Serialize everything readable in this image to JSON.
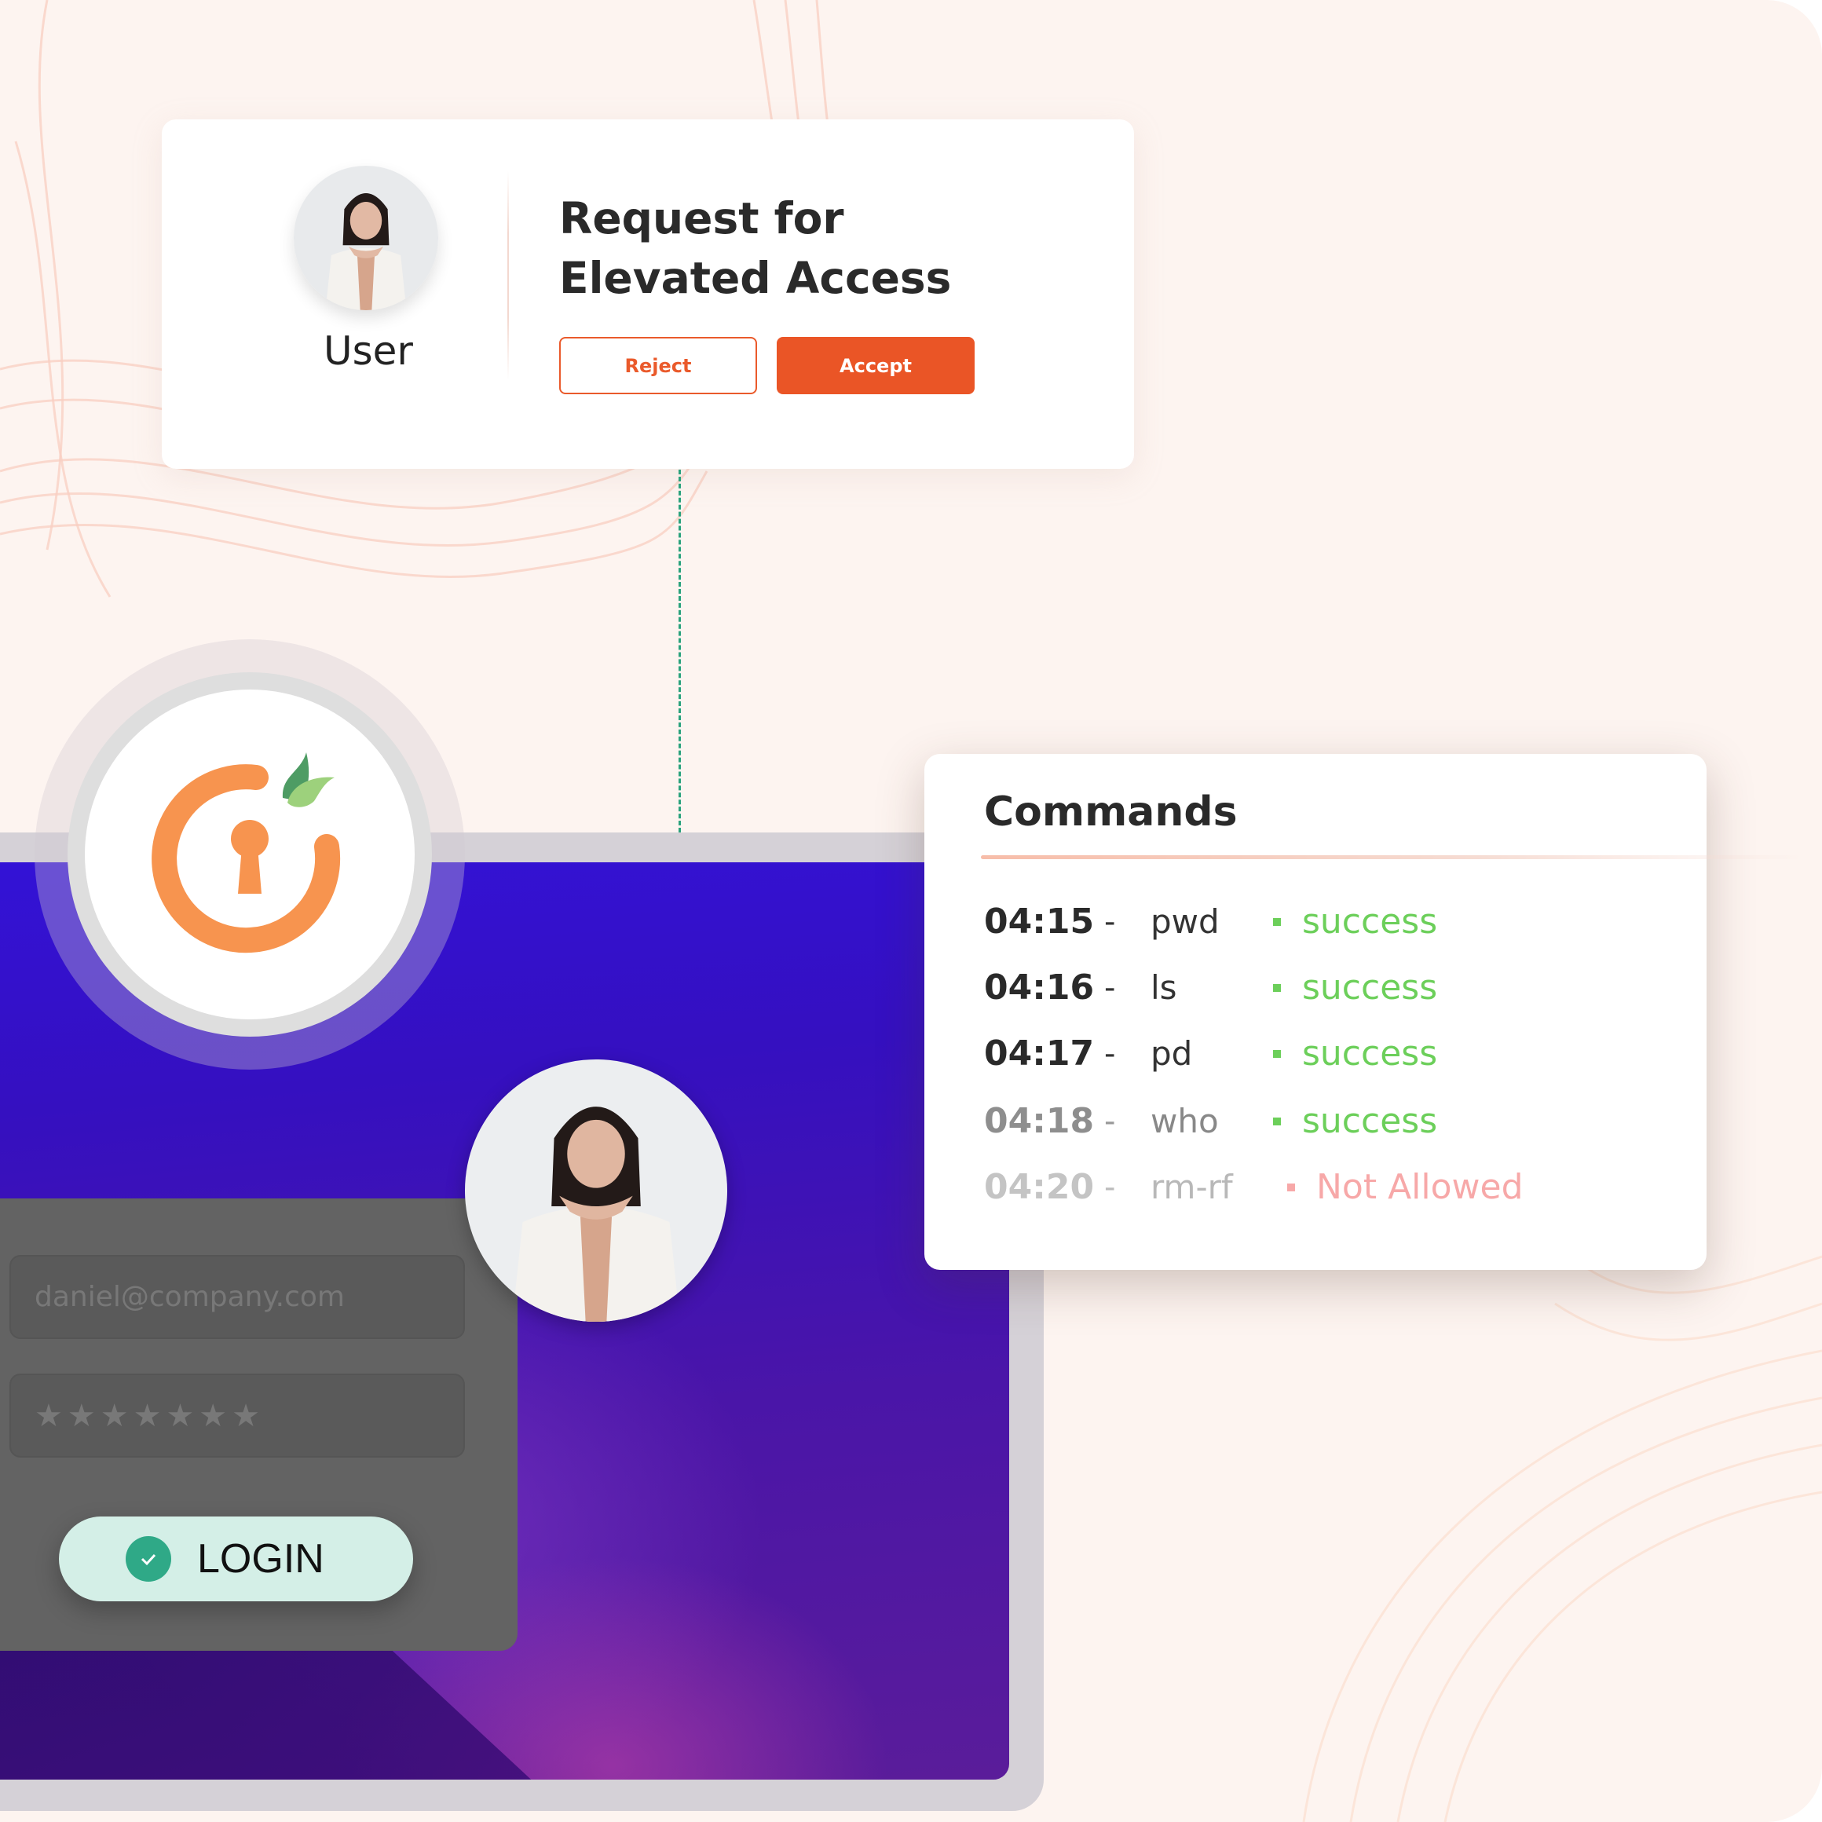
{
  "request_card": {
    "user_label": "User",
    "title": "Request for Elevated Access",
    "reject_label": "Reject",
    "accept_label": "Accept"
  },
  "login": {
    "email_placeholder": "daniel@company.com",
    "password_mask": "★★★★★★★",
    "login_label": "LOGIN"
  },
  "commands": {
    "title": "Commands",
    "rows": [
      {
        "time": "04:15",
        "sep": "-",
        "command": "pwd",
        "status": "success"
      },
      {
        "time": "04:16",
        "sep": "-",
        "command": "ls",
        "status": "success"
      },
      {
        "time": "04:17",
        "sep": "-",
        "command": "pd",
        "status": "success"
      },
      {
        "time": "04:18",
        "sep": "-",
        "command": "who",
        "status": "success"
      },
      {
        "time": "04:20",
        "sep": "-",
        "command": "rm-rf",
        "status": "Not Allowed"
      }
    ]
  },
  "colors": {
    "accent": "#ea5526",
    "success": "#6ccf5a",
    "denied": "#f7a8a8",
    "connector": "#2aa27c",
    "logo_orange": "#f7944f",
    "logo_leaf_dark": "#4e9c64",
    "logo_leaf_light": "#9dd17c"
  },
  "icons": {
    "logo": "keyhole-lock-logo-icon",
    "login_check": "check-circle-icon"
  }
}
